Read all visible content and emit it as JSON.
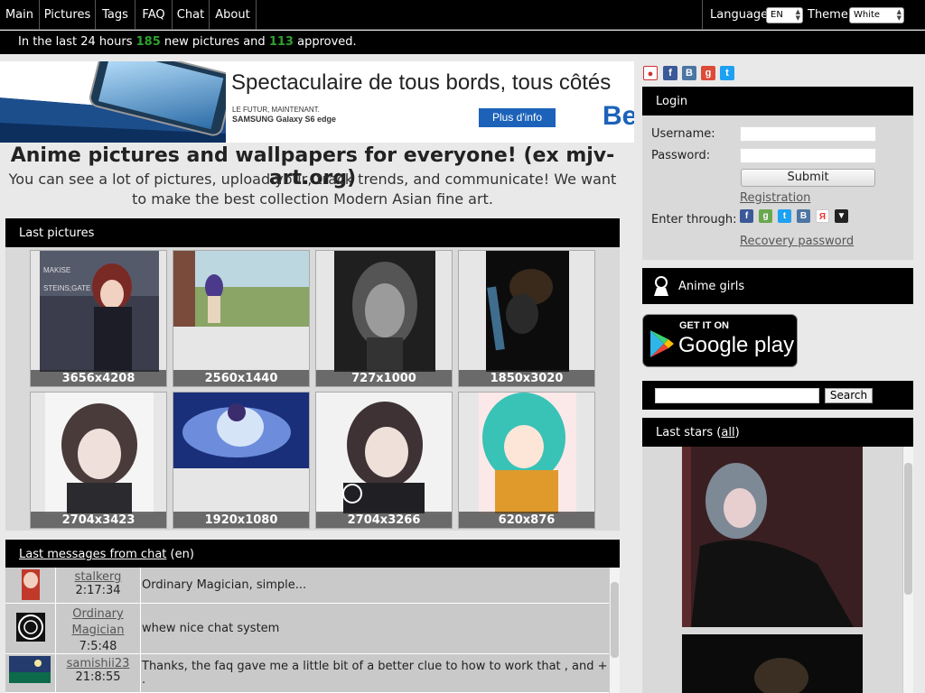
{
  "nav": {
    "items": [
      "Main",
      "Pictures",
      "Tags",
      "FAQ",
      "Chat",
      "About"
    ],
    "language_label": "Language:",
    "language_value": "EN",
    "theme_label": "Theme:",
    "theme_value": "White"
  },
  "stats": {
    "prefix": "In the last 24 hours",
    "new_count": "185",
    "middle": "new pictures and",
    "approved_count": "113",
    "suffix": "approved."
  },
  "ad": {
    "title": "Spectaculaire de tous bords, tous côtés",
    "tagline": "LE FUTUR, MAINTENANT.",
    "product": "SAMSUNG Galaxy S6 edge",
    "button": "Plus d'info",
    "logo": "Be"
  },
  "hero": {
    "title": "Anime pictures and wallpapers for everyone! (ex mjv-art.org)",
    "subtitle": "You can see a lot of pictures, upload your, track trends, and communicate! We want to make the best collection Modern Asian fine art."
  },
  "last_pictures": {
    "heading": "Last pictures",
    "items": [
      {
        "res": "3656x4208"
      },
      {
        "res": "2560x1440"
      },
      {
        "res": "727x1000"
      },
      {
        "res": "1850x3020"
      },
      {
        "res": "2704x3423"
      },
      {
        "res": "1920x1080"
      },
      {
        "res": "2704x3266"
      },
      {
        "res": "620x876"
      }
    ]
  },
  "chat": {
    "heading_link": "Last messages from chat",
    "heading_suffix": "(en)",
    "messages": [
      {
        "user": "stalkerg",
        "user2": "",
        "time": "2:17:34",
        "text": "Ordinary Magician, simple..."
      },
      {
        "user": "Ordinary",
        "user2": "Magician",
        "time": "7:5:48",
        "text": "whew nice chat system"
      },
      {
        "user": "samishii23",
        "user2": "",
        "time": "21:8:55",
        "text": "Thanks, the faq gave me a little bit of a better clue to how to work that , and + ."
      }
    ]
  },
  "login": {
    "heading": "Login",
    "username_label": "Username:",
    "password_label": "Password:",
    "submit": "Submit",
    "registration": "Registration",
    "enter_through": "Enter through:",
    "recovery": "Recovery password"
  },
  "anime_girls": {
    "label": "Anime girls"
  },
  "google_play": {
    "small": "GET IT ON",
    "big": "Google play"
  },
  "search": {
    "button": "Search"
  },
  "last_stars": {
    "prefix": "Last stars",
    "link": "all"
  }
}
